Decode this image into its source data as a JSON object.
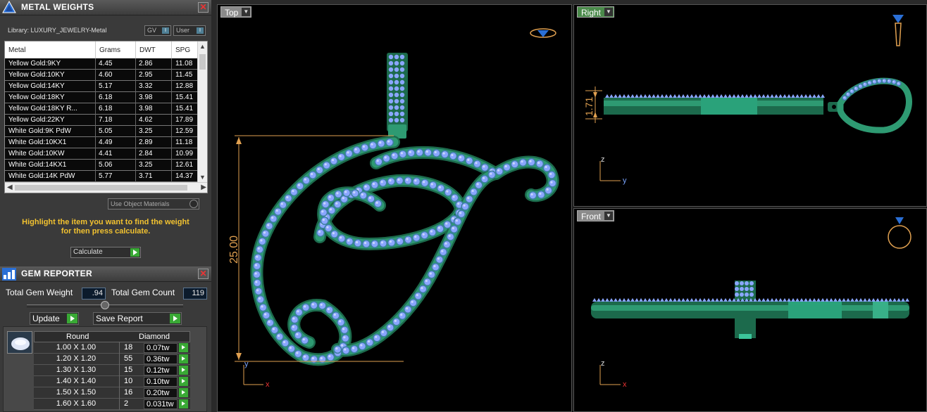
{
  "metal_panel": {
    "title": "METAL WEIGHTS",
    "library_label": "Library: LUXURY_JEWELRY-Metal",
    "gv_label": "GV",
    "user_label": "User",
    "columns": [
      "Metal",
      "Grams",
      "DWT",
      "SPG"
    ],
    "rows": [
      {
        "metal": "Yellow Gold:9KY",
        "grams": "4.45",
        "dwt": "2.86",
        "spg": "11.08"
      },
      {
        "metal": "Yellow Gold:10KY",
        "grams": "4.60",
        "dwt": "2.95",
        "spg": "11.45"
      },
      {
        "metal": "Yellow Gold:14KY",
        "grams": "5.17",
        "dwt": "3.32",
        "spg": "12.88"
      },
      {
        "metal": "Yellow Gold:18KY",
        "grams": "6.18",
        "dwt": "3.98",
        "spg": "15.41"
      },
      {
        "metal": "Yellow Gold:18KY R...",
        "grams": "6.18",
        "dwt": "3.98",
        "spg": "15.41"
      },
      {
        "metal": "Yellow Gold:22KY",
        "grams": "7.18",
        "dwt": "4.62",
        "spg": "17.89"
      },
      {
        "metal": "White Gold:9K PdW",
        "grams": "5.05",
        "dwt": "3.25",
        "spg": "12.59"
      },
      {
        "metal": "White Gold:10KX1",
        "grams": "4.49",
        "dwt": "2.89",
        "spg": "11.18"
      },
      {
        "metal": "White Gold:10KW",
        "grams": "4.41",
        "dwt": "2.84",
        "spg": "10.99"
      },
      {
        "metal": "White Gold:14KX1",
        "grams": "5.06",
        "dwt": "3.25",
        "spg": "12.61"
      },
      {
        "metal": "White Gold:14K PdW",
        "grams": "5.77",
        "dwt": "3.71",
        "spg": "14.37"
      }
    ],
    "use_object_materials": "Use Object Materials",
    "hint_line1": "Highlight the item you want to find the weight",
    "hint_line2": "for then press calculate.",
    "calculate": "Calculate"
  },
  "gem_panel": {
    "title": "GEM REPORTER",
    "total_weight_label": "Total Gem Weight",
    "total_weight": ".94",
    "total_count_label": "Total Gem Count",
    "total_count": "119",
    "update": "Update",
    "save_report": "Save Report",
    "shape_header": "Round",
    "type_header": "Diamond",
    "rows": [
      {
        "size": "1.00 X 1.00",
        "count": "18",
        "weight": "0.07tw"
      },
      {
        "size": "1.20 X 1.20",
        "count": "55",
        "weight": "0.36tw"
      },
      {
        "size": "1.30 X 1.30",
        "count": "15",
        "weight": "0.12tw"
      },
      {
        "size": "1.40 X 1.40",
        "count": "10",
        "weight": "0.10tw"
      },
      {
        "size": "1.50 X 1.50",
        "count": "16",
        "weight": "0.20tw"
      },
      {
        "size": "1.60 X 1.60",
        "count": "2",
        "weight": "0.031tw"
      }
    ]
  },
  "viewports": {
    "top": {
      "label": "Top",
      "dimension": "25.00",
      "axis_v": "y",
      "axis_h": "x"
    },
    "right": {
      "label": "Right",
      "dimension": "1.71",
      "axis_v": "z",
      "axis_h": "y"
    },
    "front": {
      "label": "Front",
      "axis_v": "z",
      "axis_h": "x"
    }
  },
  "colors": {
    "metal": "#2e9a72",
    "metal_dark": "#1c6a4c",
    "gem": "#8aa6ff",
    "dimension": "#e0a050",
    "active_tab": "#4a8a4a"
  }
}
